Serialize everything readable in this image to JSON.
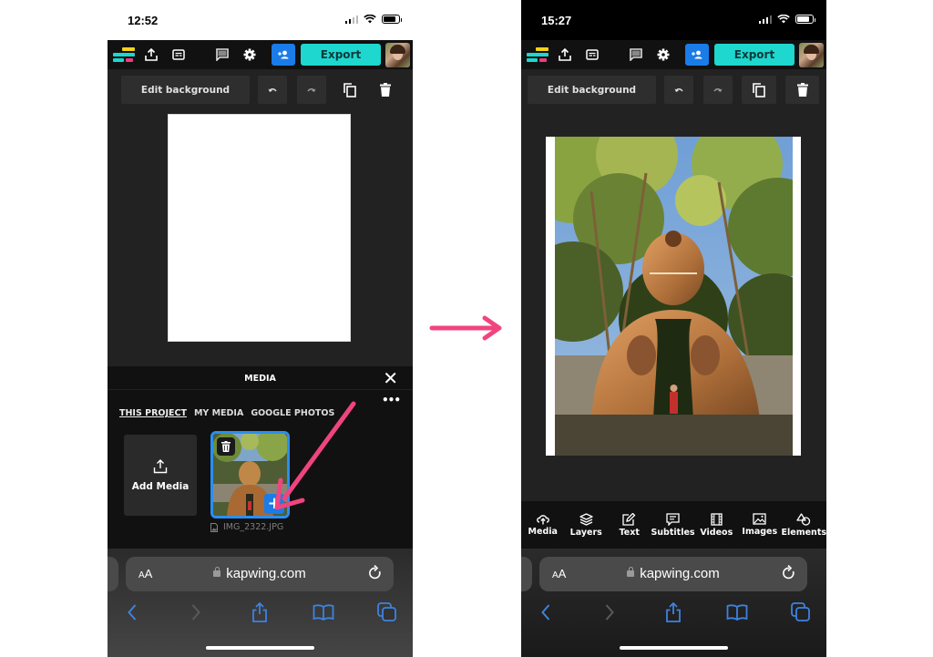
{
  "colors": {
    "accent_teal": "#1ed7ce",
    "accent_blue": "#1a7ce8",
    "annotation_pink": "#f0447f",
    "app_dark": "#111111",
    "canvas_dark": "#222222"
  },
  "left_phone": {
    "status": {
      "time": "12:52",
      "icons": [
        "signal-icon",
        "wifi-icon",
        "battery-icon"
      ]
    },
    "header": {
      "icons": [
        "kapwing-logo",
        "upload-icon",
        "subtitles-icon",
        "comment-icon",
        "gear-icon",
        "add-user-icon"
      ],
      "export_label": "Export"
    },
    "toolbar": {
      "edit_background_label": "Edit background",
      "icons": [
        "undo-icon",
        "redo-icon",
        "duplicate-icon",
        "trash-icon"
      ]
    },
    "media_panel": {
      "title": "MEDIA",
      "tabs": [
        {
          "label": "THIS PROJECT",
          "active": true
        },
        {
          "label": "MY MEDIA",
          "active": false
        },
        {
          "label": "GOOGLE PHOTOS",
          "active": false
        }
      ],
      "add_media_label": "Add Media",
      "files": [
        {
          "name": "IMG_2322.JPG"
        }
      ]
    },
    "browser": {
      "aa_label_small": "A",
      "aa_label_big": "A",
      "url": "kapwing.com"
    }
  },
  "right_phone": {
    "status": {
      "time": "15:27",
      "icons": [
        "signal-icon",
        "wifi-icon",
        "battery-icon"
      ]
    },
    "header": {
      "icons": [
        "kapwing-logo",
        "upload-icon",
        "subtitles-icon",
        "comment-icon",
        "gear-icon",
        "add-user-icon"
      ],
      "export_label": "Export"
    },
    "toolbar": {
      "edit_background_label": "Edit background",
      "icons": [
        "undo-icon",
        "redo-icon",
        "duplicate-icon",
        "trash-icon"
      ]
    },
    "tool_nav": [
      {
        "label": "Media",
        "icon": "cloud-upload-icon"
      },
      {
        "label": "Layers",
        "icon": "layers-icon"
      },
      {
        "label": "Text",
        "icon": "edit-text-icon"
      },
      {
        "label": "Subtitles",
        "icon": "subtitles-icon"
      },
      {
        "label": "Videos",
        "icon": "film-icon"
      },
      {
        "label": "Images",
        "icon": "image-icon"
      },
      {
        "label": "Elements",
        "icon": "shapes-icon"
      }
    ],
    "browser": {
      "aa_label_small": "A",
      "aa_label_big": "A",
      "url": "kapwing.com"
    }
  },
  "annotations": {
    "transition_arrow": "right-arrow",
    "pointer_arrow": "pointing to add-to-canvas button"
  }
}
